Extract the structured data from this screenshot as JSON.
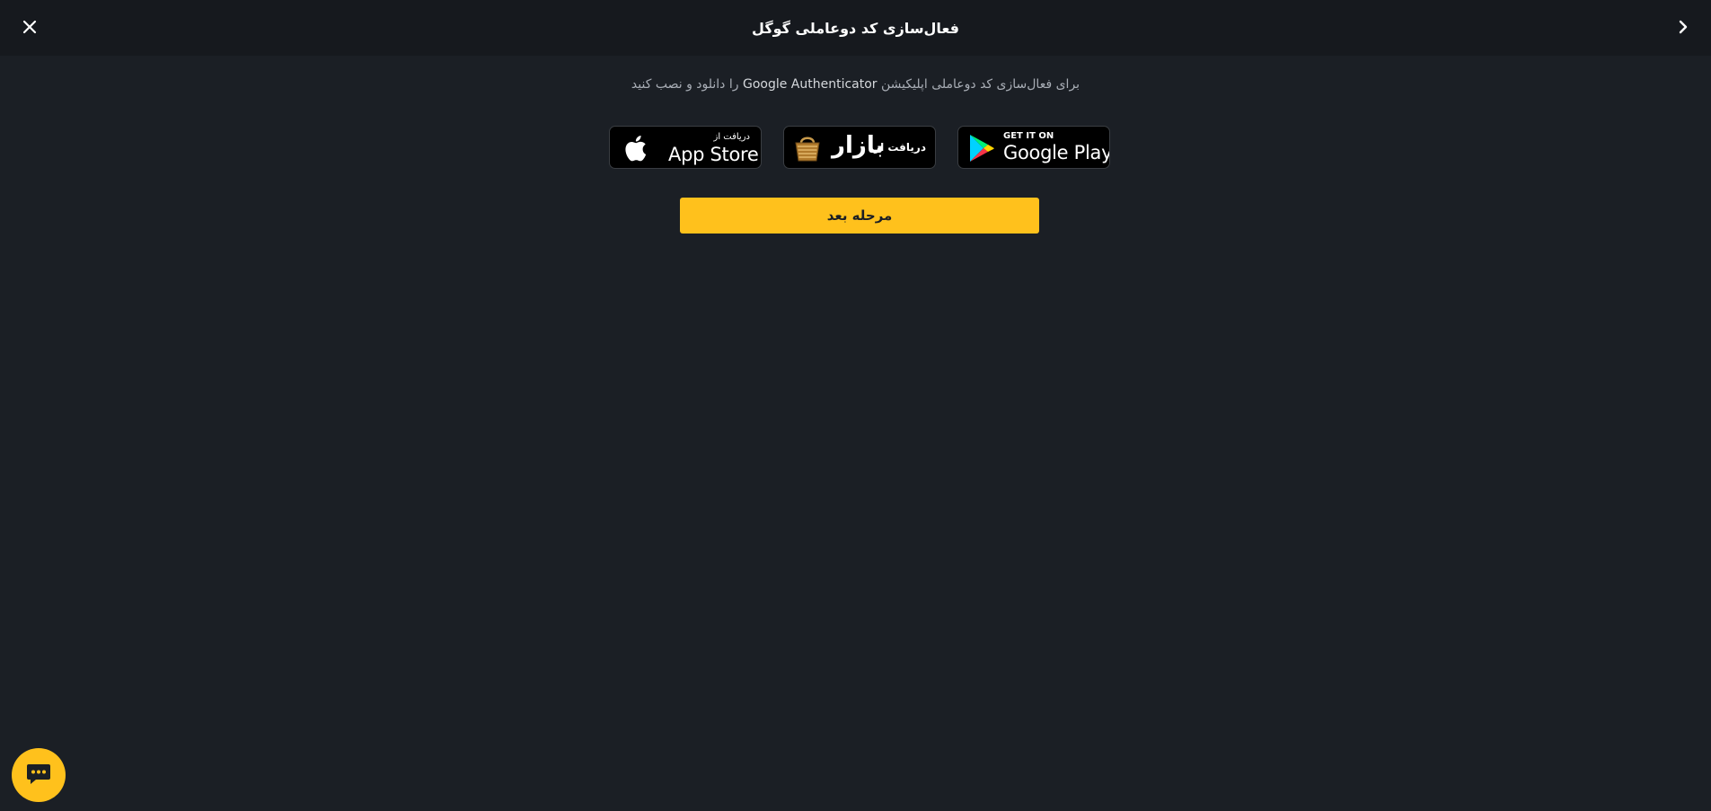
{
  "header": {
    "title": "فعال‌سازی کد دوعاملی گوگل",
    "close_icon": "close-icon",
    "back_icon": "chevron-right-icon"
  },
  "instruction": {
    "before": "برای فعال‌سازی کد دوعاملی اپلیکیشن",
    "app_name": "Google Authenticator",
    "after": "را دانلود و نصب کنید"
  },
  "badges": {
    "appstore": {
      "small": "دریافت از",
      "big": "App Store",
      "icon": "apple-icon"
    },
    "bazaar": {
      "small": "دریافت از",
      "big": "بازار",
      "icon": "bazaar-bag-icon"
    },
    "gplay": {
      "small": "GET IT ON",
      "big": "Google Play",
      "icon": "google-play-icon"
    }
  },
  "next_button": {
    "label": "مرحله بعد"
  },
  "chat": {
    "icon": "chat-icon"
  },
  "colors": {
    "accent": "#ffc11c",
    "background": "#1b1f25",
    "header_bg": "#16191e"
  }
}
